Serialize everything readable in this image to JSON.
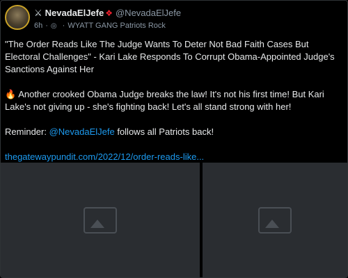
{
  "post": {
    "display_name": "NevadaElJefe",
    "handle": "@NevadaElJefe",
    "time": "6h",
    "community": "WYATT GANG Patriots Rock",
    "icons": {
      "name_prefix": "crossed-swords-icon",
      "name_suffix": "red-drop-icon",
      "audience": "globe-icon",
      "fire": "fire-icon"
    },
    "paragraphs": {
      "p1": "\"The Order Reads Like The Judge Wants To Deter Not Bad Faith Cases But Electoral Challenges\" - Kari Lake Responds To Corrupt Obama-Appointed Judge's Sanctions Against Her",
      "p2": "Another crooked Obama Judge breaks the law! It's not his first time! But Kari Lake's not giving up - she's fighting back! Let's all stand strong with her!",
      "p3_prefix": "Reminder: ",
      "p3_mention": "@NevadaElJefe",
      "p3_suffix": " follows all Patriots back!"
    },
    "link": "thegatewaypundit.com/2022/12/order-reads-like..."
  },
  "colors": {
    "background": "#000000",
    "text": "#e7e9ea",
    "muted": "#8b98a5",
    "accent": "#1d9bf0",
    "drop": "#f4212e"
  }
}
